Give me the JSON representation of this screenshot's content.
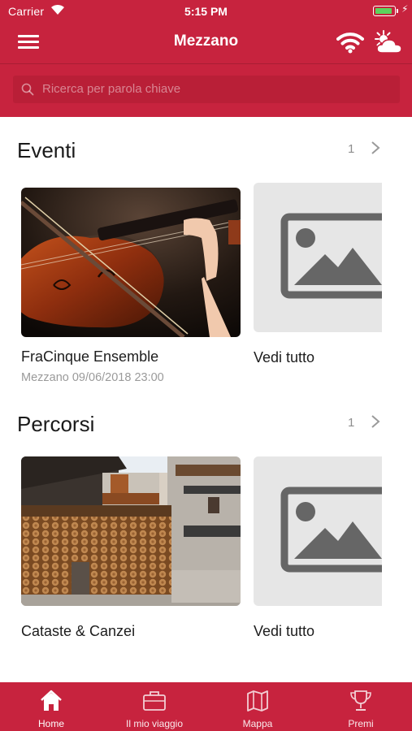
{
  "status_bar": {
    "carrier": "Carrier",
    "time": "5:15 PM",
    "battery_level": 0.9,
    "battery_color": "#5cd35c"
  },
  "header": {
    "title": "Mezzano",
    "background_color": "#c7233e",
    "menu_icon": "hamburger-menu-icon",
    "right_icons": [
      "wifi-icon",
      "weather-sun-cloud-icon"
    ]
  },
  "search": {
    "placeholder": "Ricerca per parola chiave",
    "icon": "search-icon"
  },
  "sections": [
    {
      "title": "Eventi",
      "count": "1",
      "card": {
        "title": "FraCinque Ensemble",
        "subtitle": "Mezzano 09/06/2018 23:00",
        "image": "violin-photo"
      },
      "see_all_label": "Vedi tutto"
    },
    {
      "title": "Percorsi",
      "count": "1",
      "card": {
        "title": "Cataste & Canzei",
        "subtitle": "",
        "image": "woodpile-village-photo"
      },
      "see_all_label": "Vedi tutto"
    }
  ],
  "tabbar": {
    "tabs": [
      {
        "label": "Home",
        "icon": "home-icon",
        "active": true
      },
      {
        "label": "Il mio viaggio",
        "icon": "suitcase-icon",
        "active": false
      },
      {
        "label": "Mappa",
        "icon": "map-icon",
        "active": false
      },
      {
        "label": "Premi",
        "icon": "trophy-icon",
        "active": false
      }
    ]
  }
}
